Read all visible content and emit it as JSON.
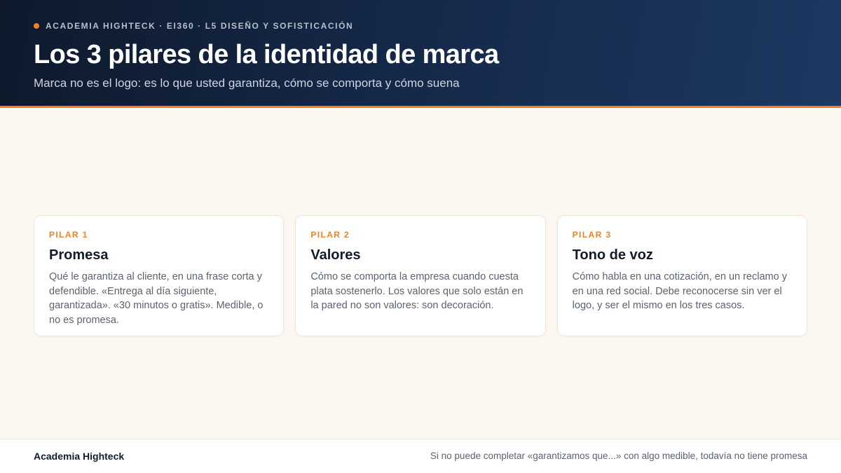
{
  "header": {
    "eyebrow": "ACADEMIA HIGHTECK · EI360 · L5 DISEÑO Y SOFISTICACIÓN",
    "title": "Los 3 pilares de la identidad de marca",
    "subtitle": "Marca no es el logo: es lo que usted garantiza, cómo se comporta y cómo suena"
  },
  "pillars": [
    {
      "kicker": "PILAR 1",
      "title": "Promesa",
      "body": "Qué le garantiza al cliente, en una frase corta y defendible. «Entrega al día siguiente, garantizada». «30 minutos o gratis». Medible, o no es promesa."
    },
    {
      "kicker": "PILAR 2",
      "title": "Valores",
      "body": "Cómo se comporta la empresa cuando cuesta plata sostenerlo. Los valores que solo están en la pared no son valores: son decoración."
    },
    {
      "kicker": "PILAR 3",
      "title": "Tono de voz",
      "body": "Cómo habla en una cotización, en un reclamo y en una red social. Debe reconocerse sin ver el logo, y ser el mismo en los tres casos."
    }
  ],
  "footer": {
    "brand": "Academia Highteck",
    "note": "Si no puede completar «garantizamos que...» con algo medible, todavía no tiene promesa"
  },
  "colors": {
    "accent": "#f47f23",
    "header_dark": "#0e1a2c",
    "header_light": "#1d3862",
    "background": "#fdf7f2"
  },
  "icons": {
    "eyebrow_marker": "orange-dot-icon"
  }
}
